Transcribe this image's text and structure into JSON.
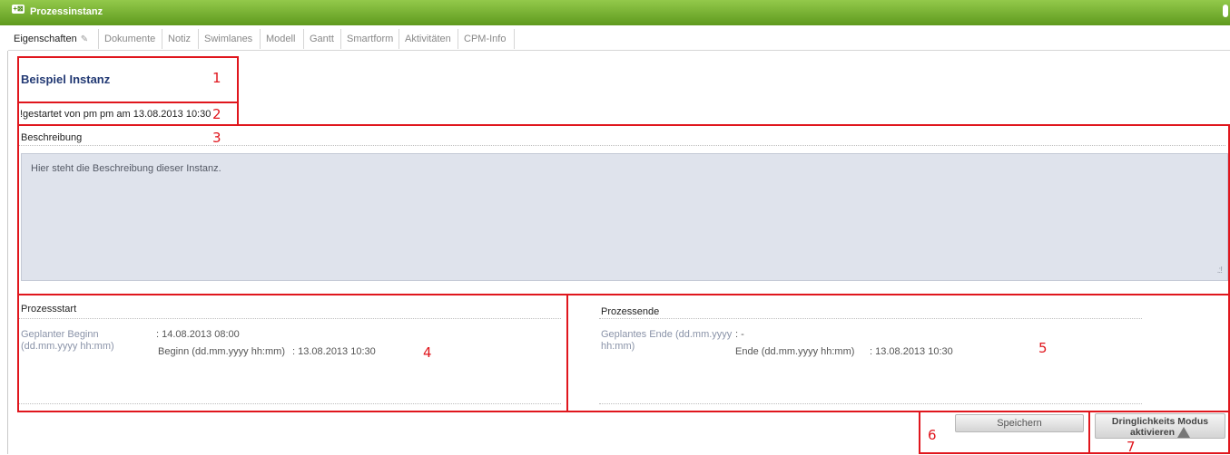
{
  "window": {
    "title": "Prozessinstanz"
  },
  "tabs": [
    {
      "label": "Eigenschaften"
    },
    {
      "label": "Dokumente"
    },
    {
      "label": "Notiz"
    },
    {
      "label": "Swimlanes"
    },
    {
      "label": "Modell"
    },
    {
      "label": "Gantt"
    },
    {
      "label": "Smartform"
    },
    {
      "label": "Aktivitäten"
    },
    {
      "label": "CPM-Info"
    }
  ],
  "instance": {
    "name": "Beispiel Instanz",
    "started_text": "!gestartet von pm pm am 13.08.2013 10:30"
  },
  "description": {
    "label": "Beschreibung",
    "value": "Hier steht die Beschreibung dieser Instanz."
  },
  "start": {
    "heading": "Prozessstart",
    "planned_label": "Geplanter Beginn (dd.mm.yyyy hh:mm)",
    "planned_value": ": 14.08.2013 08:00",
    "actual_label": "Beginn (dd.mm.yyyy hh:mm)",
    "actual_value": ": 13.08.2013 10:30"
  },
  "end": {
    "heading": "Prozessende",
    "planned_label": "Geplantes Ende (dd.mm.yyyy hh:mm)",
    "planned_value": ": -",
    "actual_label": "Ende (dd.mm.yyyy hh:mm)",
    "actual_value": ": 13.08.2013 10:30"
  },
  "buttons": {
    "save": "Speichern",
    "urgency_line1": "Dringlichkeits Modus",
    "urgency_line2": "aktivieren"
  },
  "annotations": [
    "1",
    "2",
    "3",
    "4",
    "5",
    "6",
    "7"
  ],
  "colors": {
    "titlebar": "#6aa82a",
    "annotation": "#e0161d",
    "title_text": "#233a74"
  }
}
